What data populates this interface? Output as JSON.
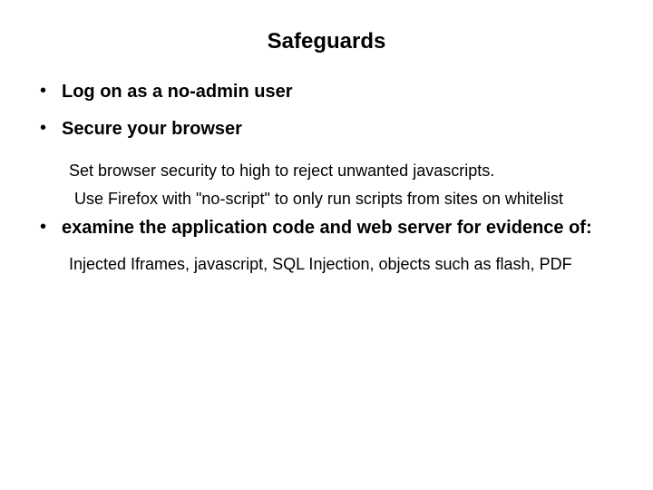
{
  "title": "Safeguards",
  "items": [
    {
      "head": "Log on as a no-admin user",
      "subs": []
    },
    {
      "head": "Secure your browser",
      "subs": [
        {
          "text": "Set browser security to high to reject unwanted javascripts.",
          "cls": "sub"
        },
        {
          "text": "Use Firefox with \"no-script\" to only run scripts from sites on whitelist",
          "cls": "sub2"
        }
      ]
    },
    {
      "head": "examine the application code and web server for evidence of:",
      "subs": [
        {
          "text": "Injected Iframes, javascript, SQL Injection,  objects such as flash, PDF",
          "cls": "sub"
        }
      ]
    }
  ]
}
